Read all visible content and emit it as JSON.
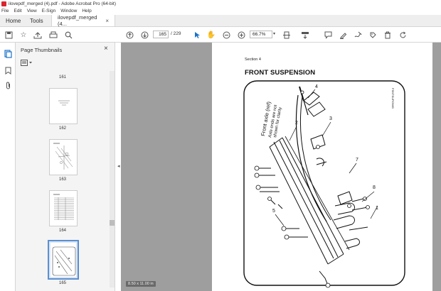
{
  "window": {
    "title": "ilovepdf_merged (4).pdf - Adobe Acrobat Pro (64-bit)"
  },
  "menu": [
    "File",
    "Edit",
    "View",
    "E-Sign",
    "Window",
    "Help"
  ],
  "tabs": {
    "home": "Home",
    "tools": "Tools",
    "document": "ilovepdf_merged (4...",
    "close": "×"
  },
  "toolbar": {
    "current_page": "165",
    "total_pages": "/ 229",
    "zoom": "66.7%"
  },
  "thumbnails": {
    "header": "Page Thumbnails",
    "close": "×",
    "pages": [
      {
        "label": "161"
      },
      {
        "label": "162"
      },
      {
        "label": "163"
      },
      {
        "label": "164"
      },
      {
        "label": "165",
        "selected": true
      }
    ]
  },
  "document": {
    "section": "Section 4",
    "title": "FRONT SUSPENSION",
    "callouts": [
      "1",
      "2",
      "3",
      "4",
      "5",
      "7",
      "8"
    ],
    "axle_label": "Front axle (ref)",
    "axle_sublabel_1": "Axle ends are not",
    "axle_sublabel_2": "shown for clarity",
    "drawing_code": "FSNTSUP.DWG",
    "page_size": "8.50 x 11.00 in"
  },
  "colors": {
    "accent": "#1a73c8",
    "app_red": "#d9262c",
    "canvas_gray": "#9e9e9e"
  }
}
